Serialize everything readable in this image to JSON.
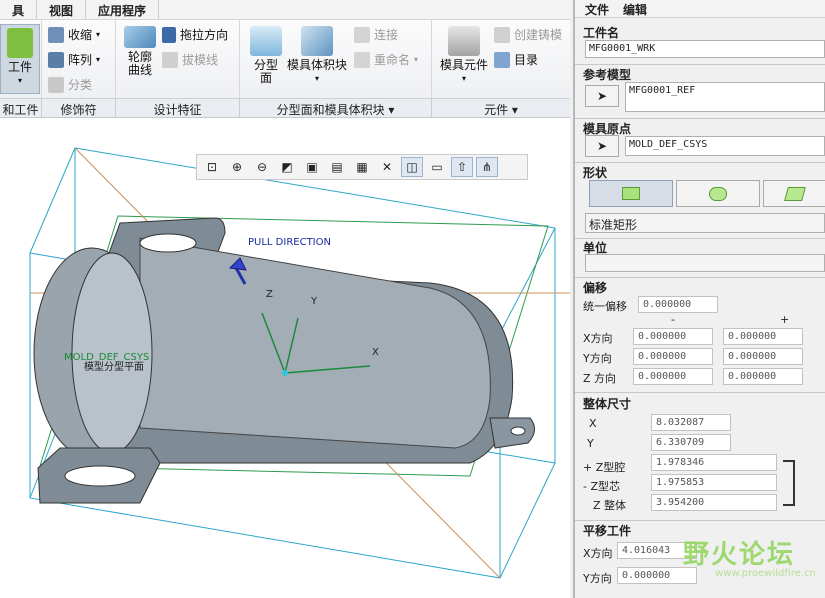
{
  "menu": {
    "items": [
      "具",
      "视图",
      "应用程序"
    ]
  },
  "ribbon": {
    "workpiece": {
      "label": "工件"
    },
    "modifiers": {
      "shrink": "收缩",
      "array": "阵列",
      "classify": "分类"
    },
    "design": {
      "pull_direction": "拖拉方向",
      "draft_check": "拔模线",
      "contour_curve_line1": "轮廓",
      "contour_curve_line2": "曲线"
    },
    "parting": {
      "parting_surface_line1": "分型",
      "parting_surface_line2": "面",
      "mold_volume": "模具体积块",
      "connect": "连接",
      "rename": "重命名"
    },
    "components": {
      "mold_component": "模具元件",
      "create_casting": "创建铸模",
      "catalog": "目录"
    },
    "groups": [
      "和工件",
      "修饰符",
      "设计特征",
      "分型面和模具体积块",
      "元件"
    ]
  },
  "viewport": {
    "pull_direction_label": "PULL DIRECTION",
    "axis_x": "X",
    "axis_y": "Y",
    "axis_z": "Z",
    "csys_label": "MOLD_DEF_CSYS",
    "plane_label": "模型分型平面"
  },
  "panel": {
    "menu": [
      "文件",
      "编辑"
    ],
    "workpiece_name_label": "工件名",
    "workpiece_name": "MFG0001_WRK",
    "ref_model_label": "参考模型",
    "ref_model": "MFG0001_REF",
    "mold_origin_label": "模具原点",
    "mold_origin": "MOLD_DEF_CSYS",
    "shape_label": "形状",
    "shape_value": "标准矩形",
    "unit_label": "单位",
    "unit_value": "",
    "offset_label": "偏移",
    "uniform_offset_label": "统一偏移",
    "uniform_offset": "0.000000",
    "minus": "-",
    "plus": "+",
    "x_dir": "X方向",
    "y_dir": "Y方向",
    "z_dir": "Z 方向",
    "x_minus": "0.000000",
    "x_plus": "0.000000",
    "y_minus": "0.000000",
    "y_plus": "0.000000",
    "z_minus": "0.000000",
    "z_plus": "0.000000",
    "overall_label": "整体尺寸",
    "size_x_label": "X",
    "size_x": "8.032087",
    "size_y_label": "Y",
    "size_y": "6.330709",
    "cavity_label": "+ Z型腔",
    "cavity": "1.978346",
    "core_label": "- Z型芯",
    "core": "1.975853",
    "total_label": "Z 整体",
    "total": "3.954200",
    "translate_label": "平移工件",
    "tx_label": "X方向",
    "tx": "4.016043",
    "ty_label": "Y方向",
    "ty": "0.000000"
  },
  "watermark": {
    "main": "野火论坛",
    "sub": "www.proewildfire.cn"
  }
}
